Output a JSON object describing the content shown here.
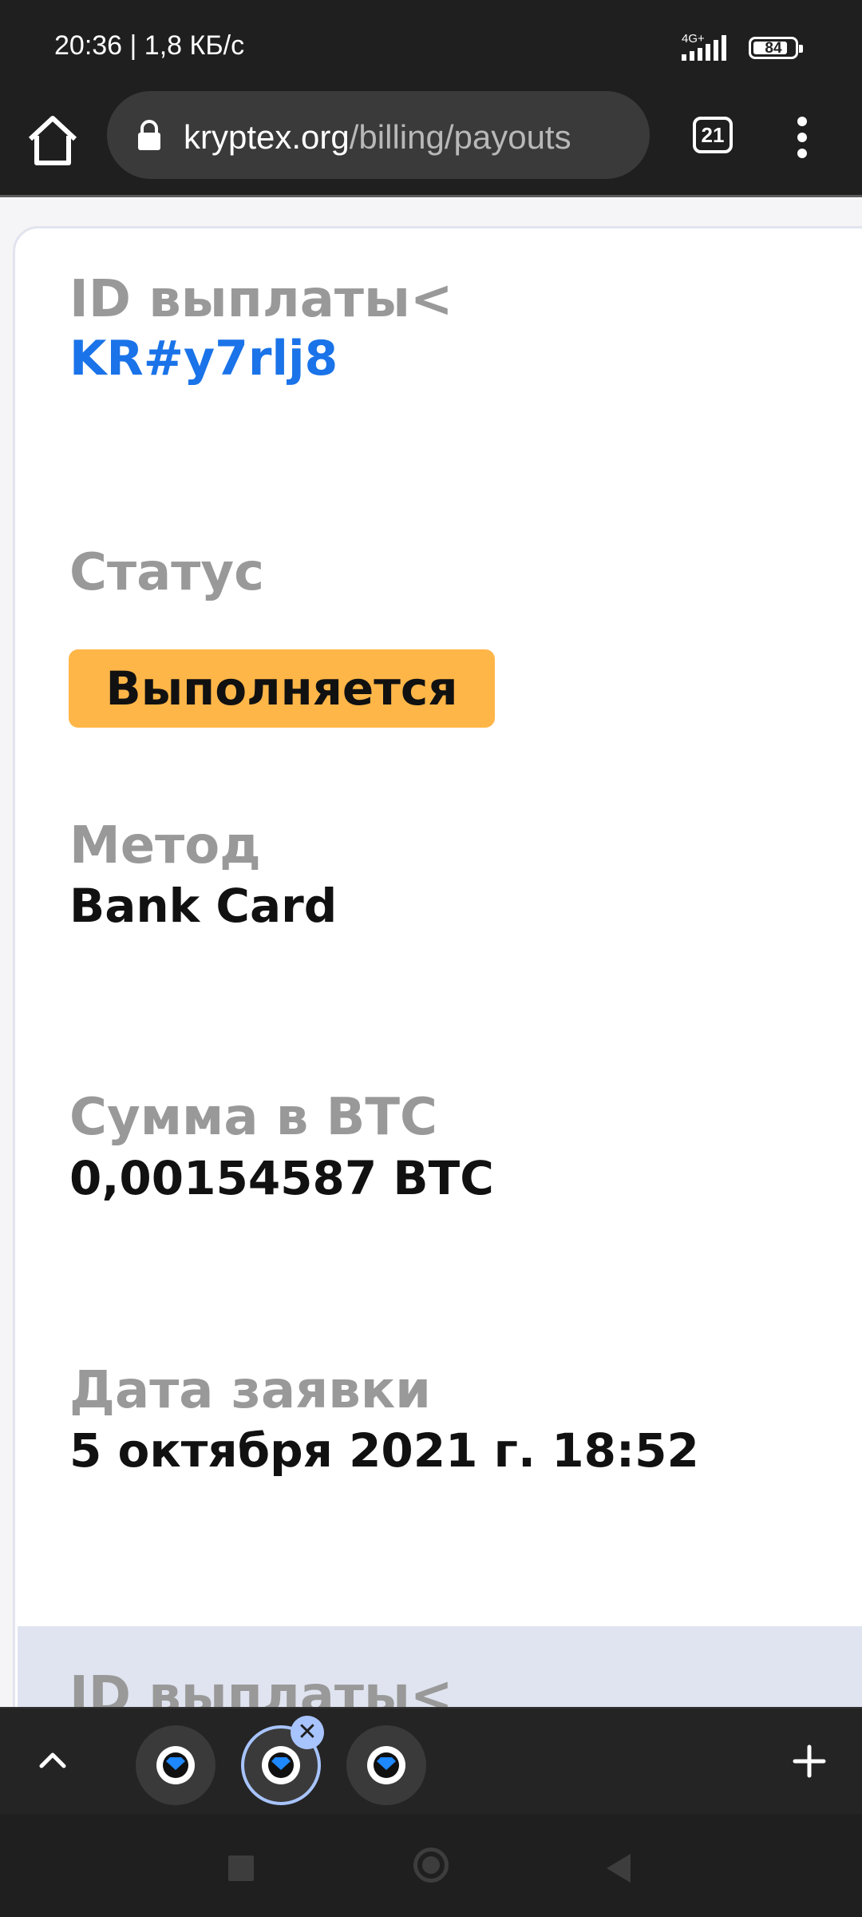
{
  "status_bar": {
    "time": "20:36 | 1,8 КБ/с",
    "network": "4G+",
    "battery": "84",
    "battery_level": 0.84
  },
  "browser": {
    "url_host": "kryptex.org",
    "url_path": "/billing/payouts",
    "tab_count": "21"
  },
  "payout": {
    "id_label": "ID выплаты<",
    "id_value": "KR#y7rlj8",
    "status_label": "Статус",
    "status_value": "Выполняется",
    "method_label": "Метод",
    "method_value": "Bank Card",
    "amount_label": "Сумма в BTC",
    "amount_value": "0,00154587 BTC",
    "date_label": "Дата заявки",
    "date_value": "5 октября 2021 г. 18:52"
  },
  "next_payout": {
    "id_label": "ID выплаты<"
  },
  "tab_strip": {
    "close_glyph": "✕"
  },
  "colors": {
    "link": "#1a73e8",
    "status_badge": "#ffb648",
    "label_gray": "#999999",
    "next_row_bg": "#e0e4f0",
    "active_tab_ring": "#a8c4ff"
  }
}
